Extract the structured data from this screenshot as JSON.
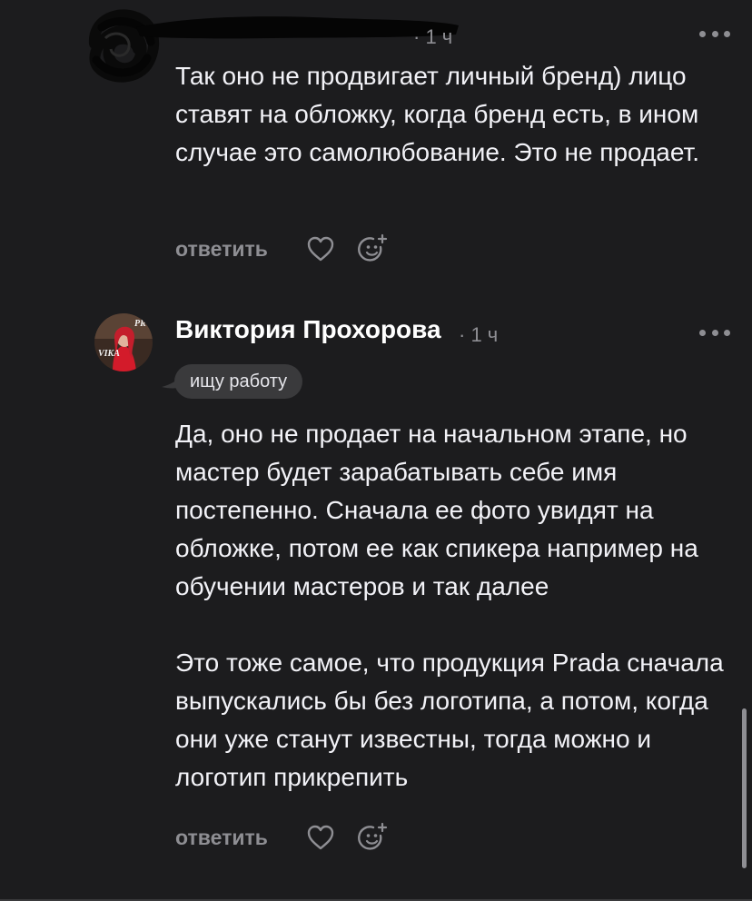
{
  "comments": [
    {
      "author_redacted": true,
      "time": "· 1 ч",
      "text": "Так оно не продвигает личный бренд) лицо ставят на обложку, когда бренд есть, в ином случае это самолюбование. Это не продает.",
      "reply_label": "ответить"
    },
    {
      "author": "Виктория Прохорова",
      "time": "· 1 ч",
      "badge": "ищу работу",
      "text": "Да, оно не продает на начальном этапе, но мастер будет зарабатывать себе имя постепенно. Сначала ее фото увидят на обложке, потом ее как спикера например на обучении мастеров и так далее\n\nЭто тоже самое, что продукция Prada сначала выпускались бы без логотипа, а потом, когда они уже станут известны, тогда можно и логотип прикрепить",
      "reply_label": "ответить",
      "avatar_text": "VIKA"
    }
  ],
  "icons": {
    "like": "heart-icon",
    "react": "add-reaction-icon",
    "more": "more-options-icon"
  },
  "colors": {
    "background": "#1c1c1e",
    "text": "#f2f2f7",
    "secondary": "#8e8e93",
    "badge_bg": "#3a3a3c"
  }
}
